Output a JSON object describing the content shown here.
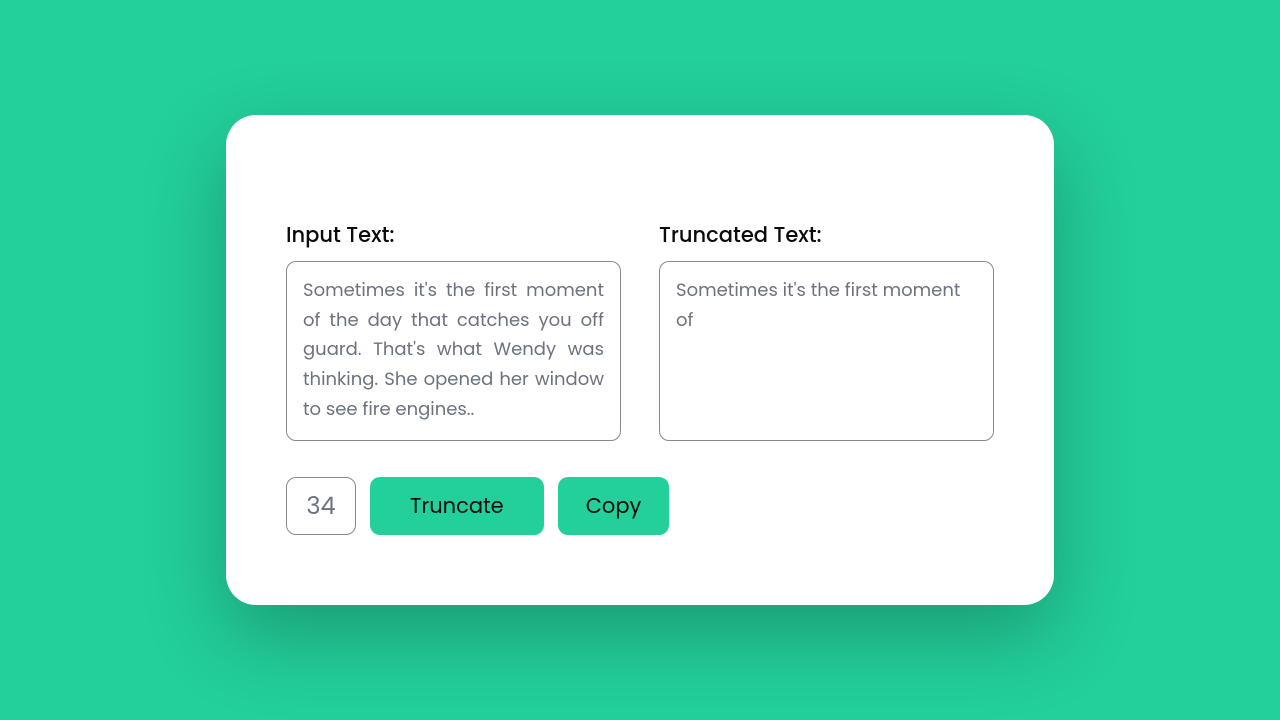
{
  "labels": {
    "input": "Input Text:",
    "output": "Truncated Text:"
  },
  "text": {
    "input": "Sometimes it's the first moment of the day that catches you off guard. That's what Wendy was thinking. She opened her window to see fire engines..",
    "output": "Sometimes it's the first moment of"
  },
  "controls": {
    "length_value": "34",
    "truncate_label": "Truncate",
    "copy_label": "Copy"
  },
  "colors": {
    "accent": "#23cf9b",
    "card_bg": "#ffffff",
    "text_muted": "#6b7280",
    "border": "#8a8a8a"
  }
}
